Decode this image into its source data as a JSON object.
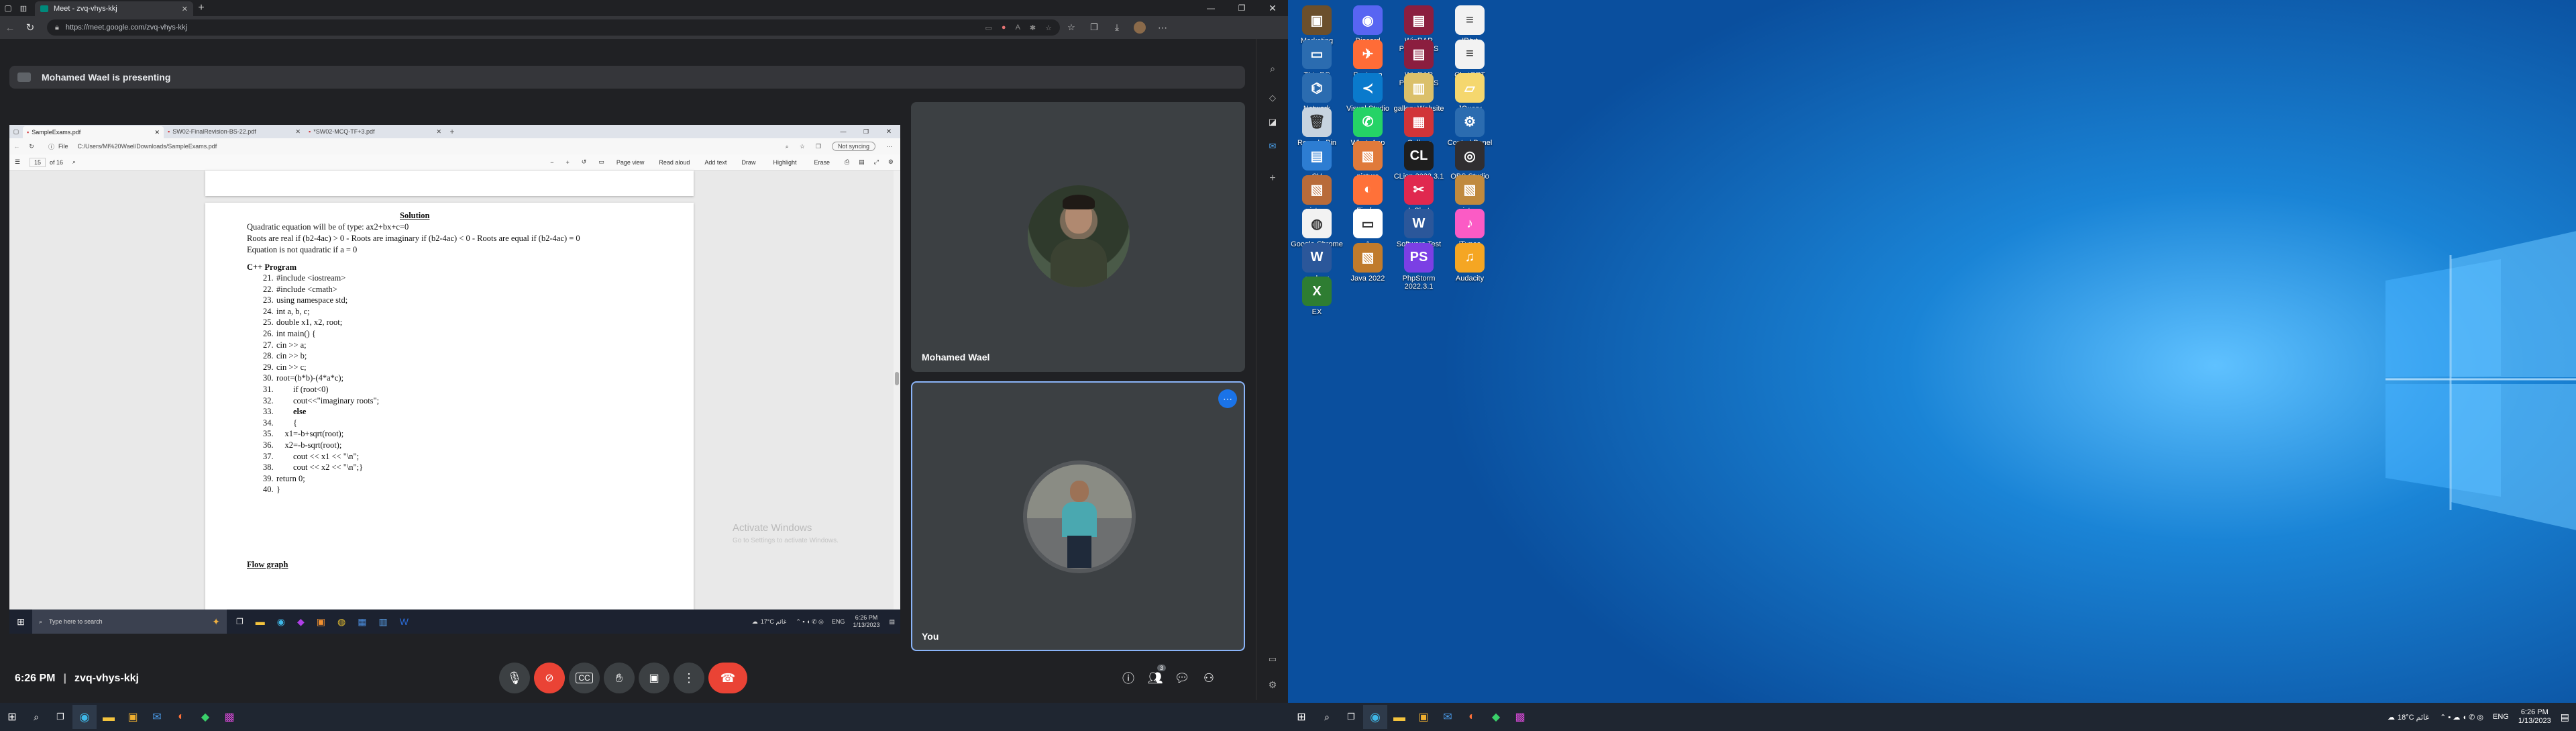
{
  "browser": {
    "tab_title": "Meet - zvq-vhys-kkj",
    "url": "https://meet.google.com/zvq-vhys-kkj"
  },
  "presenting_banner": "Mohamed Wael is presenting",
  "shared": {
    "tabs": [
      "SampleExams.pdf",
      "SW02-FinalRevision-BS-22.pdf",
      "*SW02-MCQ-TF+3.pdf"
    ],
    "file_label": "File",
    "path": "C:/Users/Ml%20Wael/Downloads/SampleExams.pdf",
    "sync": "Not syncing",
    "page_number": "15",
    "page_total": "of 16",
    "toolbar": {
      "page_view": "Page view",
      "read_aloud": "Read aloud",
      "add_text": "Add text",
      "draw": "Draw",
      "highlight": "Highlight",
      "erase": "Erase"
    },
    "doc": {
      "solution": "Solution",
      "lines": [
        "Quadratic equation will be of type: ax2+bx+c=0",
        "Roots are real if (b2-4ac) > 0 - Roots are imaginary if (b2-4ac) < 0 - Roots are equal if (b2-4ac) = 0",
        "Equation is not quadratic if a = 0"
      ],
      "cpp_heading": "C++ Program",
      "code": [
        [
          "21.",
          "#include <iostream>"
        ],
        [
          "22.",
          "#include <cmath>"
        ],
        [
          "23.",
          "using namespace std;"
        ],
        [
          "24.",
          "int a, b, c;"
        ],
        [
          "25.",
          "double x1, x2, root;"
        ],
        [
          "26.",
          "int main() {"
        ],
        [
          "27.",
          "cin >> a;"
        ],
        [
          "28.",
          "cin >> b;"
        ],
        [
          "29.",
          "cin >> c;"
        ],
        [
          "30.",
          "root=(b*b)-(4*a*c);"
        ],
        [
          "31.",
          "        if (root<0)"
        ],
        [
          "32.",
          "        cout<<\"imaginary roots\";"
        ],
        [
          "33.",
          "        else"
        ],
        [
          "34.",
          "        {"
        ],
        [
          "35.",
          "    x1=-b+sqrt(root);"
        ],
        [
          "36.",
          "    x2=-b-sqrt(root);"
        ],
        [
          "37.",
          "        cout << x1 << \"\\n\";"
        ],
        [
          "38.",
          "        cout << x2 << \"\\n\";}"
        ],
        [
          "39.",
          "return 0;"
        ],
        [
          "40.",
          "}"
        ]
      ],
      "flow_graph": "Flow graph"
    },
    "activate_title": "Activate Windows",
    "activate_sub": "Go to Settings to activate Windows.",
    "taskbar": {
      "search": "Type here to search",
      "weather": "17°C  غائم",
      "lang": "ENG",
      "time": "6:26 PM",
      "date": "1/13/2023"
    }
  },
  "participants": [
    {
      "name": "Mohamed Wael"
    },
    {
      "name": "You"
    }
  ],
  "bottom_bar": {
    "time": "6:26 PM",
    "meeting_code": "zvq-vhys-kkj",
    "participant_count": "3"
  },
  "desktop": {
    "icons": [
      [
        "Marketing Strategy",
        "#6b4f2c",
        "▣"
      ],
      [
        "Discord",
        "#5865f2",
        "◉"
      ],
      [
        "WinRAR PROJECTS",
        "#8b1e3f",
        "▤"
      ],
      [
        "IP.txt",
        "#f2f2f2",
        "≡"
      ],
      [
        "This PC",
        "#2b6cb0",
        "▭"
      ],
      [
        "Postman",
        "#ff6c37",
        "✈"
      ],
      [
        "WinRAR PROJECTS",
        "#8b1e3f",
        "▤"
      ],
      [
        "ChatGPT",
        "#f2f2f2",
        "≡"
      ],
      [
        "Network",
        "#2b6cb0",
        "⌬"
      ],
      [
        "Visual Studio Code",
        "#0a7acc",
        "≺"
      ],
      [
        "gallery Website",
        "#dbc06a",
        "▥"
      ],
      [
        "JQuery",
        "#f5d76e",
        "▱"
      ],
      [
        "Recycle Bin",
        "#c7d3df",
        "🗑"
      ],
      [
        "WhatsApp",
        "#25d366",
        "✆"
      ],
      [
        "Gallery",
        "#d13438",
        "▦"
      ],
      [
        "Control Panel",
        "#2b6cb0",
        "⚙"
      ],
      [
        "CV",
        "#2d7dd2",
        "▤"
      ],
      [
        "picture",
        "#e07a3b",
        "▧"
      ],
      [
        "CLion 2022.3.1",
        "#1e1e1e",
        "CL"
      ],
      [
        "OBS Studio",
        "#302e31",
        "◎"
      ],
      [
        "picture",
        "#b86b3a",
        "▧"
      ],
      [
        "Firefox",
        "#ff7139",
        "◐"
      ],
      [
        "InShot",
        "#e0284f",
        "✂"
      ],
      [
        "picture",
        "#c08a3e",
        "▧"
      ],
      [
        "Google Chrome",
        "#f2f2f2",
        "◍"
      ],
      [
        "1",
        "#ffffff",
        "▭"
      ],
      [
        "Software Test",
        "#2b579a",
        "W"
      ],
      [
        "iTunes",
        "#fb5bc5",
        "♪"
      ],
      [
        "cv.docx",
        "#2b579a",
        "W"
      ],
      [
        "Java 2022",
        "#c07b2c",
        "▧"
      ],
      [
        "PhpStorm 2022.3.1",
        "#7b3fe4",
        "PS"
      ],
      [
        "Audacity",
        "#f5a623",
        "♫"
      ],
      [
        "EX",
        "#2e7d32",
        "X"
      ]
    ],
    "taskbar": {
      "weather": "18°C  غائم",
      "lang": "ENG",
      "time": "6:26 PM",
      "date": "1/13/2023"
    }
  },
  "colors": {
    "accent": "#8ab4f8",
    "end_call": "#ea4335",
    "chrome_bg": "#202124",
    "desktop_bg": "#0a64b8"
  }
}
